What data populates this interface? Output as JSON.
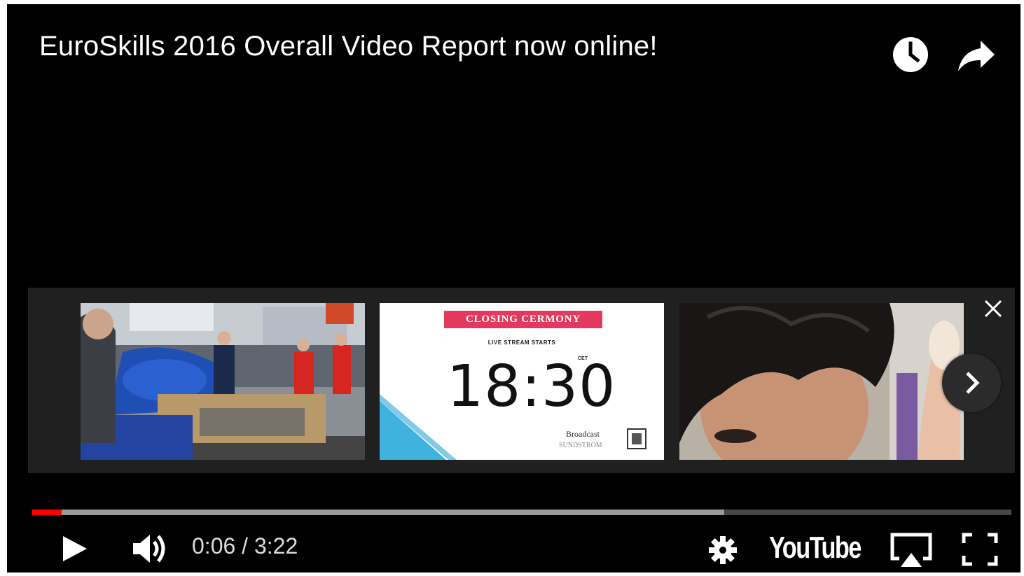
{
  "video": {
    "title": "EuroSkills 2016 Overall Video Report now online!",
    "current_time": "0:06",
    "duration": "3:22",
    "played_fraction": 0.03,
    "loaded_fraction": 0.707
  },
  "endscreen": {
    "ceremony_card": {
      "banner": "CLOSING CERMONY",
      "subtitle": "LIVE STREAM STARTS",
      "time": "18:30",
      "timezone": "CET",
      "sponsor1": "Broadcast",
      "sponsor2": "SUNDSTROM"
    }
  },
  "controls": {
    "logo_text": "YouTube"
  },
  "colors": {
    "accent": "#ff0000",
    "endscreen_bg": "#202020",
    "banner": "#e4385e"
  },
  "icons": [
    "watch-later-icon",
    "share-icon",
    "close-icon",
    "chevron-right-icon",
    "play-icon",
    "volume-icon",
    "settings-icon",
    "airplay-icon",
    "fullscreen-icon"
  ]
}
